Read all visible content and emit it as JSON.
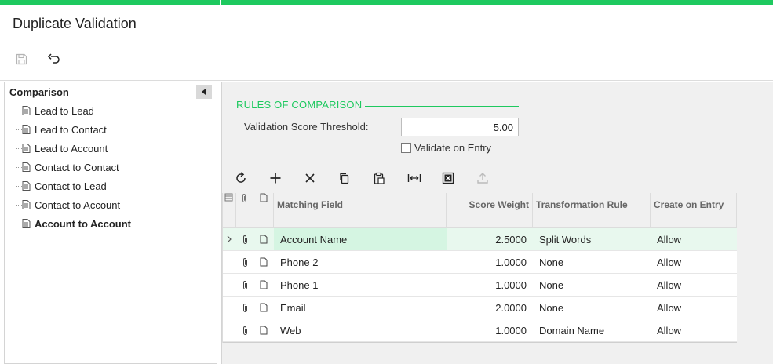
{
  "page": {
    "title": "Duplicate Validation",
    "accent_color": "#1ec95f"
  },
  "top_toolbar": {
    "save_icon": "save-icon",
    "undo_icon": "undo-icon"
  },
  "tree": {
    "header": "Comparison",
    "items": [
      {
        "label": "Lead to Lead",
        "selected": false
      },
      {
        "label": "Lead to Contact",
        "selected": false
      },
      {
        "label": "Lead to Account",
        "selected": false
      },
      {
        "label": "Contact to Contact",
        "selected": false
      },
      {
        "label": "Contact to Lead",
        "selected": false
      },
      {
        "label": "Contact to Account",
        "selected": false
      },
      {
        "label": "Account to Account",
        "selected": true
      }
    ]
  },
  "rules": {
    "section_title": "RULES OF COMPARISON",
    "threshold_label": "Validation Score Threshold:",
    "threshold_value": "5.00",
    "validate_on_entry_label": "Validate on Entry",
    "validate_on_entry_checked": false
  },
  "grid_toolbar": [
    "refresh-icon",
    "add-icon",
    "delete-icon",
    "copy-icon",
    "paste-icon",
    "fit-to-width-icon",
    "export-excel-icon",
    "upload-icon"
  ],
  "grid": {
    "columns": {
      "field": "Matching Field",
      "score": "Score Weight",
      "transformation": "Transformation Rule",
      "create": "Create on Entry"
    },
    "rows": [
      {
        "field": "Account Name",
        "score": "2.5000",
        "transformation": "Split Words",
        "create": "Allow"
      },
      {
        "field": "Phone 2",
        "score": "1.0000",
        "transformation": "None",
        "create": "Allow"
      },
      {
        "field": "Phone 1",
        "score": "1.0000",
        "transformation": "None",
        "create": "Allow"
      },
      {
        "field": "Email",
        "score": "2.0000",
        "transformation": "None",
        "create": "Allow"
      },
      {
        "field": "Web",
        "score": "1.0000",
        "transformation": "Domain Name",
        "create": "Allow"
      }
    ]
  }
}
